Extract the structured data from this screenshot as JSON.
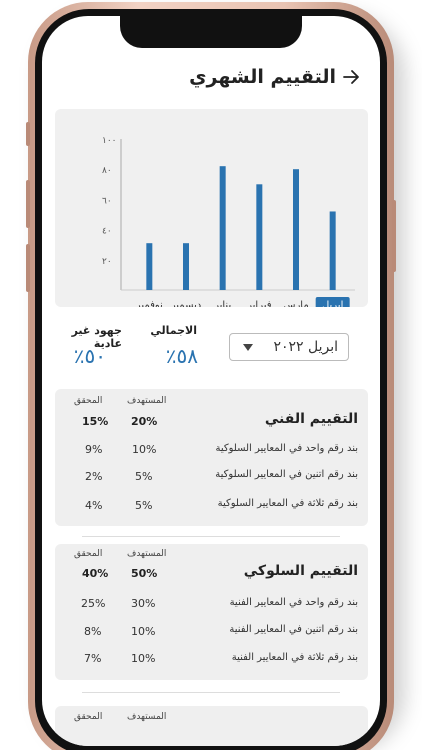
{
  "page": {
    "title": "التقييم الشهري"
  },
  "chart_data": {
    "type": "bar",
    "categories": [
      "ابريل",
      "مارس",
      "فبراير",
      "يناير",
      "ديسمبر",
      "نوفمبر"
    ],
    "values": [
      52,
      80,
      70,
      82,
      31,
      31
    ],
    "selected_category": "ابريل",
    "y_ticks": [
      "٢٠",
      "٤٠",
      "٦٠",
      "٨٠",
      "١٠٠"
    ],
    "ylim": [
      0,
      100
    ],
    "bar_color": "#2a73b0"
  },
  "summary": {
    "month_select_value": "ابريل ٢٠٢٢",
    "total_label": "الاجمالي",
    "total_value": "٥٨٪",
    "extra_label": "جهود غير عادية",
    "extra_value": "٥٠٪"
  },
  "technical": {
    "title": "التقييم الفني",
    "target_header": "المستهدف",
    "achieved_header": "المحقق",
    "total_target": "20%",
    "total_achieved": "15%",
    "rows": [
      {
        "label": "بند رقم واحد في المعايير السلوكية",
        "target": "10%",
        "achieved": "9%"
      },
      {
        "label": "بند رقم اتنين في المعايير السلوكية",
        "target": "5%",
        "achieved": "2%"
      },
      {
        "label": "بند رقم ثلاثة في المعايير السلوكية",
        "target": "5%",
        "achieved": "4%"
      }
    ]
  },
  "behavioral": {
    "title": "التقييم السلوكي",
    "target_header": "المستهدف",
    "achieved_header": "المحقق",
    "total_target": "50%",
    "total_achieved": "40%",
    "rows": [
      {
        "label": "بند رقم واحد في المعايير الفنية",
        "target": "30%",
        "achieved": "25%"
      },
      {
        "label": "بند رقم اتنين في المعايير الفنية",
        "target": "10%",
        "achieved": "8%"
      },
      {
        "label": "بند رقم ثلاثة في المعايير الفنية",
        "target": "10%",
        "achieved": "7%"
      }
    ]
  },
  "third_card": {
    "target_header": "المستهدف",
    "achieved_header": "المحقق"
  }
}
